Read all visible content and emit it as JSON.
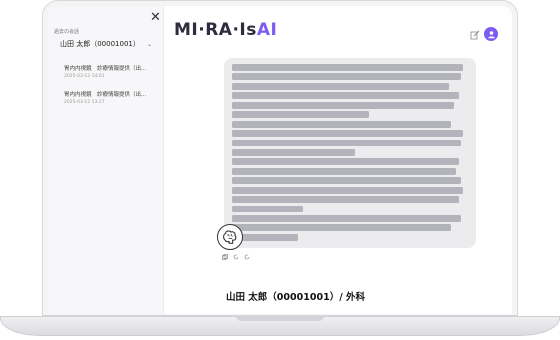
{
  "sidebar": {
    "heading": "過去の会話",
    "patient_label": "山田 太郎（00001001）",
    "history": [
      {
        "title": "胃内内視鏡　診療情報提供（出...",
        "date": "2025-03-12 14:01"
      },
      {
        "title": "胃内内視鏡　診療情報提供（出...",
        "date": "2025-03-12 13:27"
      }
    ]
  },
  "header": {
    "logo_main": "MI·RA·Is",
    "logo_ai": "AI",
    "avatar_icon": "user-icon",
    "accent": "#7c5cf2"
  },
  "patient_header": {
    "title": "山田 太郎（00001001）/ 外科"
  },
  "colors": {
    "bubble": "#ececef",
    "sidebar": "#f7f7f9"
  }
}
